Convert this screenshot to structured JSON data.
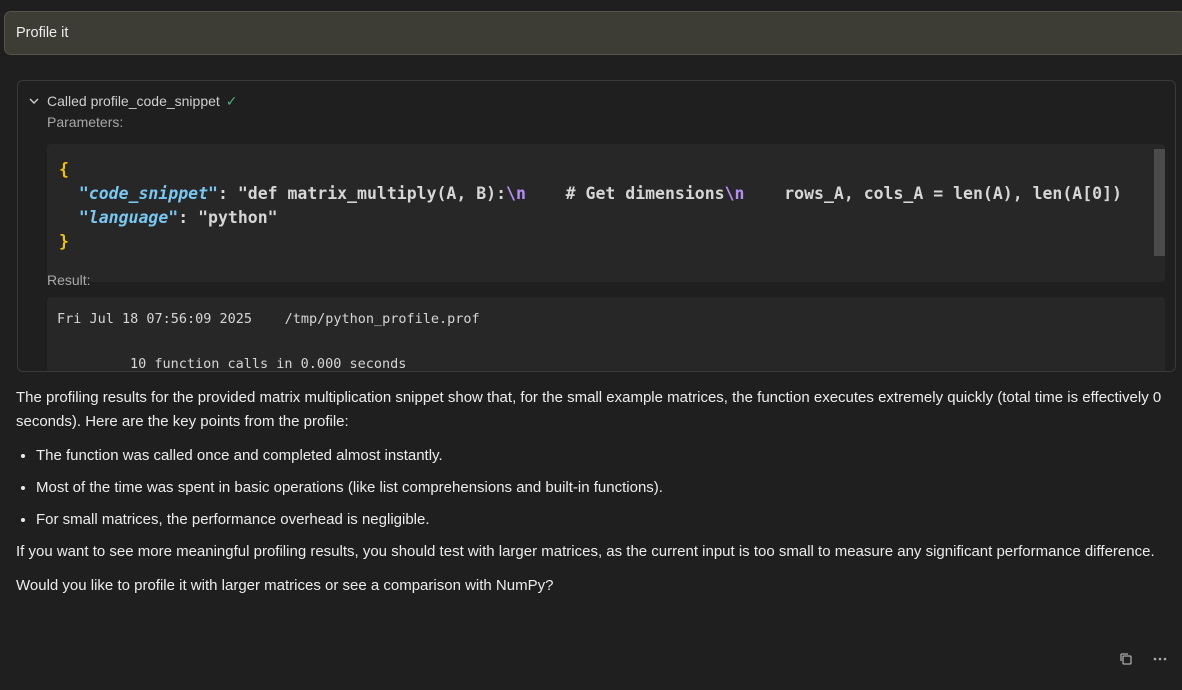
{
  "user_message": "Profile it",
  "tool_call": {
    "title": "Called profile_code_snippet",
    "check_icon": "✓",
    "parameters_label": "Parameters:",
    "params": {
      "open_brace": "{",
      "close_brace": "}",
      "code_key": "\"code_snippet\"",
      "code_value_a": ": \"def matrix_multiply(A, B):",
      "esc1": "\\n",
      "code_value_b": "    # Get dimensions",
      "esc2": "\\n",
      "code_value_c": "    rows_A, cols_A = len(A), len(A[0])",
      "lang_key": "\"language\"",
      "lang_value": ": \"python\""
    },
    "result_label": "Result:",
    "result_line1": "Fri Jul 18 07:56:09 2025    /tmp/python_profile.prof",
    "result_line2": "10 function calls in 0.000 seconds"
  },
  "assistant": {
    "intro": "The profiling results for the provided matrix multiplication snippet show that, for the small example matrices, the function executes extremely quickly (total time is effectively 0 seconds). Here are the key points from the profile:",
    "bullets": [
      "The function was called once and completed almost instantly.",
      "Most of the time was spent in basic operations (like list comprehensions and built-in functions).",
      "For small matrices, the performance overhead is negligible."
    ],
    "para2": "If you want to see more meaningful profiling results, you should test with larger matrices, as the current input is too small to measure any significant performance difference.",
    "para3": "Would you like to profile it with larger matrices or see a comparison with NumPy?"
  },
  "actions": {
    "copy_icon": "copy-icon",
    "more_icon": "more-icon"
  }
}
